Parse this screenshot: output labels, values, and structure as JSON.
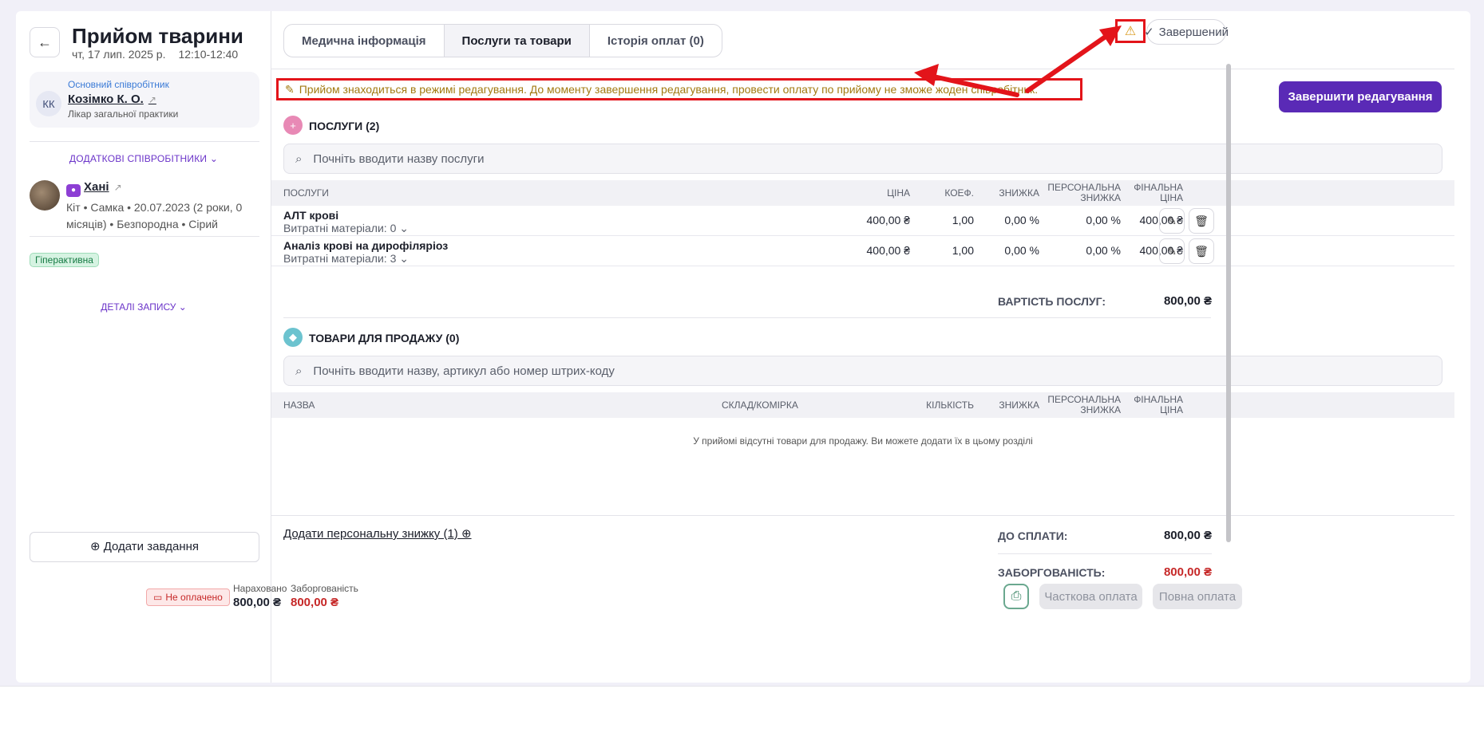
{
  "header": {
    "title": "Прийом тварини",
    "date": "чт, 17 лип. 2025 р.",
    "time": "12:10-12:40",
    "back_icon": "←"
  },
  "staff": {
    "role_label": "Основний співробітник",
    "initials": "КК",
    "name": "Козімко К. О.",
    "specialty": "Лікар загальної практики",
    "extra_staff_label": "ДОДАТКОВІ СПІВРОБІТНИКИ"
  },
  "pet": {
    "name": "Хані",
    "info": "Кіт • Самка • 20.07.2023 (2 роки, 0 місяців) • Безпородна • Сірий",
    "tag": "Гіперактивна",
    "record_details_label": "ДЕТАЛІ ЗАПИСУ"
  },
  "sidebar": {
    "add_task_label": "Додати завдання"
  },
  "tabs": [
    {
      "label": "Медична інформація",
      "active": false
    },
    {
      "label": "Послуги та товари",
      "active": true
    },
    {
      "label": "Історія оплат (0)",
      "active": false
    }
  ],
  "status": {
    "warning_icon": "⚠",
    "label": "Завершений"
  },
  "notice": "Прийом знаходиться в режимі редагування. До моменту завершення редагування, провести оплату по прийому не зможе жоден співробітник.",
  "finish_edit_label": "Завершити редагування",
  "services": {
    "title": "ПОСЛУГИ (2)",
    "search_placeholder": "Почніть вводити назву послуги",
    "columns": [
      "ПОСЛУГИ",
      "ЦІНА",
      "КОЕФ.",
      "ЗНИЖКА",
      "ПЕРСОНАЛЬНА ЗНИЖКА",
      "ФІНАЛЬНА ЦІНА"
    ],
    "rows": [
      {
        "name": "АЛТ крові",
        "materials": "Витратні матеріали: 0",
        "price": "400,00 ₴",
        "coef": "1,00",
        "discount": "0,00 %",
        "personal": "0,00 %",
        "final": "400,00 ₴"
      },
      {
        "name": "Аналіз крові на дирофіляріоз",
        "materials": "Витратні матеріали: 3",
        "price": "400,00 ₴",
        "coef": "1,00",
        "discount": "0,00 %",
        "personal": "0,00 %",
        "final": "400,00 ₴"
      }
    ],
    "total_label": "ВАРТІСТЬ ПОСЛУГ:",
    "total_value": "800,00 ₴"
  },
  "goods": {
    "title": "ТОВАРИ ДЛЯ ПРОДАЖУ (0)",
    "search_placeholder": "Почніть вводити назву, артикул або номер штрих-коду",
    "columns": [
      "НАЗВА",
      "СКЛАД/КОМІРКА",
      "КІЛЬКІСТЬ",
      "ЗНИЖКА",
      "ПЕРСОНАЛЬНА ЗНИЖКА",
      "ФІНАЛЬНА ЦІНА"
    ],
    "empty_message": "У прийомі відсутні товари для продажу. Ви можете додати їх в цьому розділі"
  },
  "summary": {
    "add_discount_label": "Додати персональну знижку (1)",
    "to_pay_label": "ДО СПЛАТИ:",
    "to_pay_value": "800,00 ₴",
    "debt_label": "ЗАБОРГОВАНІСТЬ:",
    "debt_value": "800,00 ₴"
  },
  "footer": {
    "unpaid_label": "Не оплачено",
    "accrued_label": "Нараховано",
    "accrued_value": "800,00 ₴",
    "debt_label": "Заборгованість",
    "debt_value": "800,00 ₴",
    "partial_pay_label": "Часткова оплата",
    "full_pay_label": "Повна оплата"
  },
  "colors": {
    "accent": "#5a2ab6",
    "debt": "#c62828",
    "annotation": "#e3141a"
  }
}
